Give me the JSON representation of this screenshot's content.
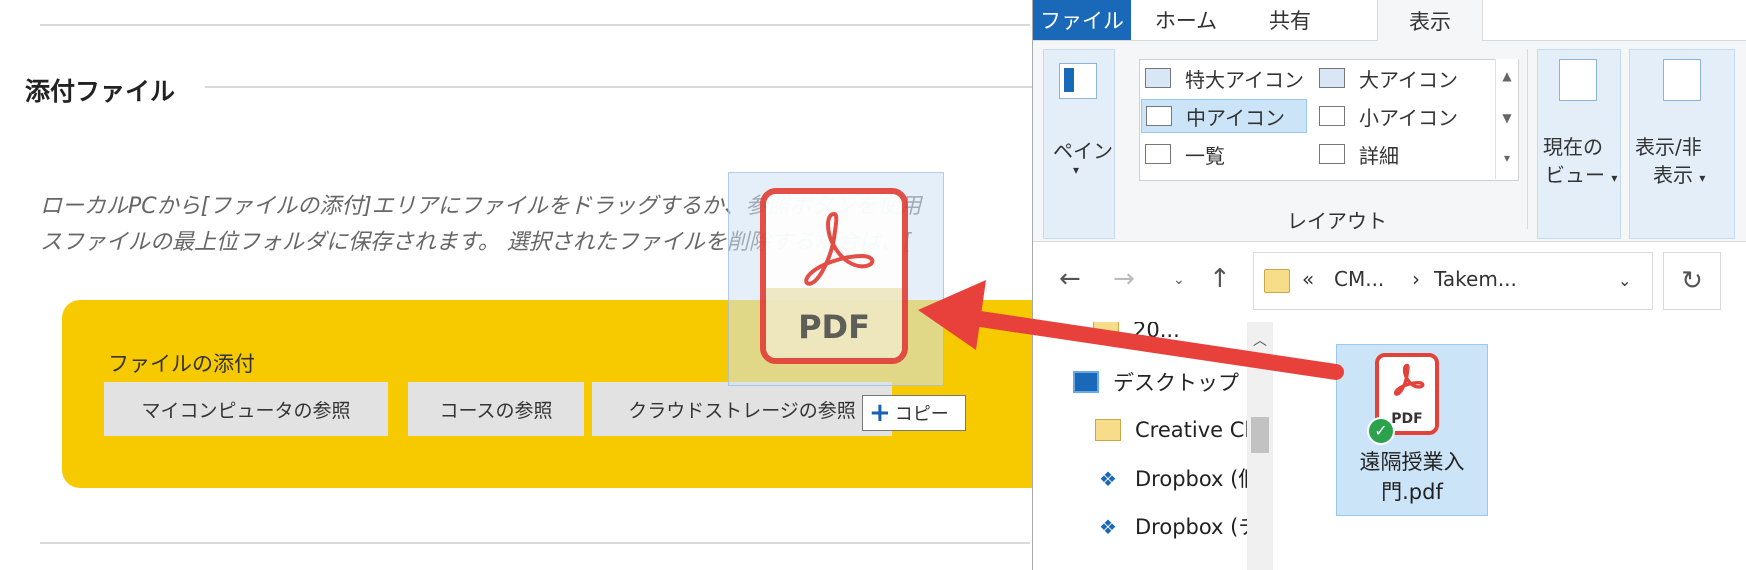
{
  "page": {
    "section_title": "添付ファイル",
    "description_line1": "ローカルPCから[ファイルの添付]エリアにファイルをドラッグするか、参照ボタンを使用",
    "description_line2": "スファイルの最上位フォルダに保存されます。 選択されたファイルを削除する場合は、[",
    "attach_label": "ファイルの添付",
    "buttons": {
      "browse_computer": "マイコンピュータの参照",
      "browse_course": "コースの参照",
      "cloud_storage": "クラウドストレージの参照"
    },
    "copy_tooltip": "コピー",
    "drag_icon_text": "PDF"
  },
  "explorer": {
    "tabs": [
      "ファイル",
      "ホーム",
      "共有",
      "表示"
    ],
    "ribbon": {
      "pane_label": "ペイン",
      "layout_items": [
        "特大アイコン",
        "大アイコン",
        "中アイコン",
        "小アイコン",
        "一覧",
        "詳細"
      ],
      "layout_group_label": "レイアウト",
      "current_view_label_1": "現在の",
      "current_view_label_2": "ビュー",
      "show_hide_label_1": "表示/非",
      "show_hide_label_2": "表示"
    },
    "address": {
      "prefix": "«",
      "crumbs": [
        "CM...",
        "Takem..."
      ]
    },
    "tree": {
      "items": [
        "20...",
        "デスクトップ",
        "Creative Clo",
        "Dropbox (個",
        "Dropbox (チ"
      ]
    },
    "file": {
      "icon_text": "PDF",
      "name_line1": "遠隔授業入",
      "name_line2": "門.pdf"
    }
  },
  "colors": {
    "attach_area": "#f7ca00",
    "file_tab": "#1a68b8",
    "selection": "#cce4f7",
    "pdf_red": "#e3423a",
    "arrow_red": "#e8413c"
  }
}
